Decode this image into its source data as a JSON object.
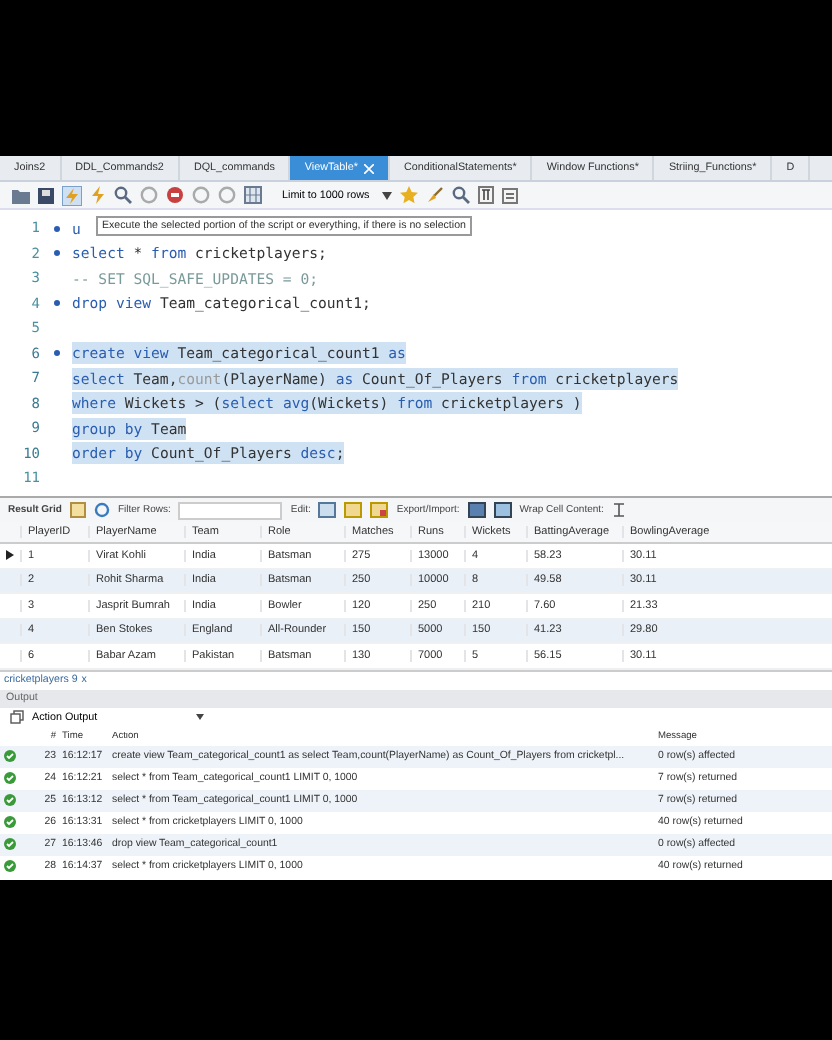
{
  "tabs": [
    {
      "label": "Joins2",
      "selected": false,
      "closable": false
    },
    {
      "label": "DDL_Commands2",
      "selected": false,
      "closable": false
    },
    {
      "label": "DQL_commands",
      "selected": false,
      "closable": false
    },
    {
      "label": "ViewTable*",
      "selected": true,
      "closable": true
    },
    {
      "label": "ConditionalStatements*",
      "selected": false,
      "closable": false
    },
    {
      "label": "Window Functions*",
      "selected": false,
      "closable": false
    },
    {
      "label": "Striing_Functions*",
      "selected": false,
      "closable": false
    },
    {
      "label": "D",
      "selected": false,
      "closable": false
    }
  ],
  "toolbar": {
    "limit": "Limit to 1000 rows"
  },
  "tooltip": "Execute the selected portion of the script or everything, if there is no selection",
  "editor": {
    "lines": [
      {
        "number": "1",
        "marker": true,
        "selected": false,
        "segments": [
          {
            "t": "u",
            "kind": "keyword"
          }
        ]
      },
      {
        "number": "2",
        "marker": true,
        "selected": false,
        "segments": [
          {
            "t": "select",
            "kind": "keyword"
          },
          {
            "t": " * ",
            "kind": "identifier"
          },
          {
            "t": "from",
            "kind": "keyword"
          },
          {
            "t": " cricketplayers;",
            "kind": "identifier"
          }
        ]
      },
      {
        "number": "3",
        "marker": false,
        "selected": false,
        "segments": [
          {
            "t": "-- SET SQL_SAFE_UPDATES = 0;",
            "kind": "comment"
          }
        ]
      },
      {
        "number": "4",
        "marker": true,
        "selected": false,
        "segments": [
          {
            "t": "drop view",
            "kind": "keyword"
          },
          {
            "t": " Team_categorical_count1;",
            "kind": "identifier"
          }
        ]
      },
      {
        "number": "5",
        "marker": false,
        "selected": false
      },
      {
        "number": "6",
        "marker": true,
        "selected": true,
        "segments": [
          {
            "t": "create view",
            "kind": "keyword"
          },
          {
            "t": " Team_categorical_count1 ",
            "kind": "identifier"
          },
          {
            "t": "as",
            "kind": "keyword"
          }
        ]
      },
      {
        "number": "7",
        "marker": false,
        "selected": true,
        "segments": [
          {
            "t": "select",
            "kind": "keyword"
          },
          {
            "t": " Team,",
            "kind": "identifier"
          },
          {
            "t": "count",
            "kind": "function"
          },
          {
            "t": "(PlayerName) ",
            "kind": "identifier"
          },
          {
            "t": "as",
            "kind": "keyword"
          },
          {
            "t": " Count_Of_Players ",
            "kind": "identifier"
          },
          {
            "t": "from",
            "kind": "keyword"
          },
          {
            "t": " cricketplayers",
            "kind": "identifier"
          }
        ]
      },
      {
        "number": "8",
        "marker": false,
        "selected": true,
        "segments": [
          {
            "t": "where",
            "kind": "keyword"
          },
          {
            "t": " Wickets > (",
            "kind": "identifier"
          },
          {
            "t": "select avg",
            "kind": "keyword"
          },
          {
            "t": "(Wickets) ",
            "kind": "identifier"
          },
          {
            "t": "from",
            "kind": "keyword"
          },
          {
            "t": " cricketplayers )",
            "kind": "identifier"
          }
        ]
      },
      {
        "number": "9",
        "marker": false,
        "selected": true,
        "segments": [
          {
            "t": "group by",
            "kind": "keyword"
          },
          {
            "t": " Team",
            "kind": "identifier"
          }
        ]
      },
      {
        "number": "10",
        "marker": false,
        "selected": true,
        "segments": [
          {
            "t": "order by",
            "kind": "keyword"
          },
          {
            "t": " Count_Of_Players ",
            "kind": "identifier"
          },
          {
            "t": "desc",
            "kind": "keyword"
          },
          {
            "t": ";",
            "kind": "identifier"
          }
        ]
      },
      {
        "number": "11",
        "marker": false,
        "selected": false
      }
    ]
  },
  "result_toolbar": {
    "grid_label": "Result Grid",
    "filter_label": "Filter Rows:",
    "edit_label": "Edit:",
    "export_label": "Export/Import:",
    "wrap_label": "Wrap Cell Content:"
  },
  "result": {
    "columns": [
      "PlayerID",
      "PlayerName",
      "Team",
      "Role",
      "Matches",
      "Runs",
      "Wickets",
      "BattingAverage",
      "BowlingAverage"
    ],
    "rows": [
      {
        "current": true,
        "cells": [
          "1",
          "Virat Kohli",
          "India",
          "Batsman",
          "275",
          "13000",
          "4",
          "58.23",
          "30.11"
        ]
      },
      {
        "current": false,
        "cells": [
          "2",
          "Rohit Sharma",
          "India",
          "Batsman",
          "250",
          "10000",
          "8",
          "49.58",
          "30.11"
        ]
      },
      {
        "current": false,
        "cells": [
          "3",
          "Jasprit Bumrah",
          "India",
          "Bowler",
          "120",
          "250",
          "210",
          "7.60",
          "21.33"
        ]
      },
      {
        "current": false,
        "cells": [
          "4",
          "Ben Stokes",
          "England",
          "All-Rounder",
          "150",
          "5000",
          "150",
          "41.23",
          "29.80"
        ]
      },
      {
        "current": false,
        "cells": [
          "6",
          "Babar Azam",
          "Pakistan",
          "Batsman",
          "130",
          "7000",
          "5",
          "56.15",
          "30.11"
        ]
      }
    ]
  },
  "result_tab": {
    "label": "cricketplayers 9",
    "close": "x"
  },
  "output": {
    "title": "Output",
    "selector": "Action Output",
    "columns": [
      "#",
      "Time",
      "Action",
      "Message"
    ],
    "rows": [
      {
        "kind": "success",
        "number": "23",
        "time": "16:12:17",
        "action": "create view Team_categorical_count1 as  select Team,count(PlayerName) as Count_Of_Players from cricketpl...",
        "message": "0 row(s) affected"
      },
      {
        "kind": "success",
        "number": "24",
        "time": "16:12:21",
        "action": "select * from Team_categorical_count1 LIMIT 0, 1000",
        "message": "7 row(s) returned"
      },
      {
        "kind": "success",
        "number": "25",
        "time": "16:13:12",
        "action": "select * from Team_categorical_count1 LIMIT 0, 1000",
        "message": "7 row(s) returned"
      },
      {
        "kind": "success",
        "number": "26",
        "time": "16:13:31",
        "action": "select * from cricketplayers LIMIT 0, 1000",
        "message": "40 row(s) returned"
      },
      {
        "kind": "success",
        "number": "27",
        "time": "16:13:46",
        "action": "drop view Team_categorical_count1",
        "message": "0 row(s) affected"
      },
      {
        "kind": "success",
        "number": "28",
        "time": "16:14:37",
        "action": "select * from cricketplayers LIMIT 0, 1000",
        "message": "40 row(s) returned"
      }
    ]
  }
}
